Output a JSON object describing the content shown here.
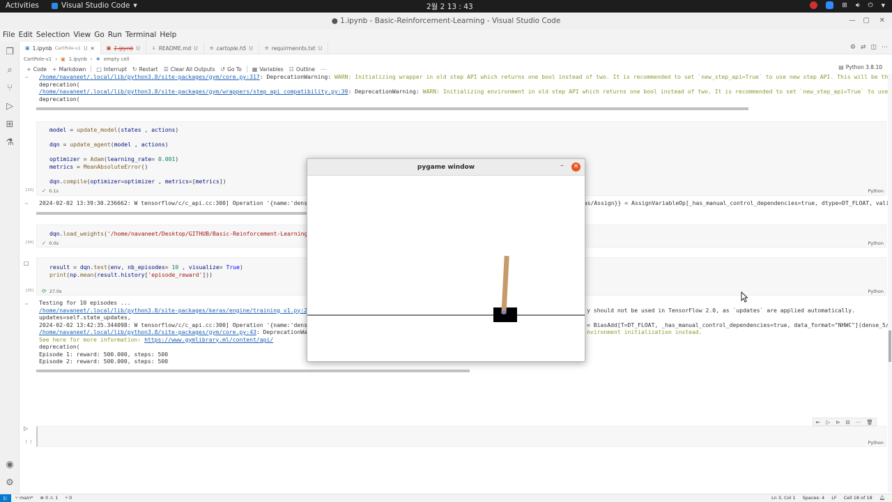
{
  "gnome": {
    "activities": "Activities",
    "app_name": "Visual Studio Code",
    "clock": "2월 2  13 : 43"
  },
  "window": {
    "title": "● 1.ipynb - Basic-Reinforcement-Learning - Visual Studio Code"
  },
  "menu": [
    "File",
    "Edit",
    "Selection",
    "View",
    "Go",
    "Run",
    "Terminal",
    "Help"
  ],
  "tabs": [
    {
      "label": "1.ipynb",
      "sub": "CartPole-v1",
      "mod": "U",
      "active": true
    },
    {
      "label": "1.ipynb",
      "sub": "",
      "mod": "U",
      "active": false
    },
    {
      "label": "README.md",
      "sub": "",
      "mod": "U",
      "active": false
    },
    {
      "label": "cartople.h5",
      "sub": "",
      "mod": "U",
      "active": false
    },
    {
      "label": "requirmennts.txt",
      "sub": "",
      "mod": "U",
      "active": false
    }
  ],
  "breadcrumb": [
    "CartPole-v1",
    "1.ipynb",
    "empty cell"
  ],
  "toolbar": {
    "code": "Code",
    "markdown": "Markdown",
    "interrupt": "Interrupt",
    "restart": "Restart",
    "clear": "Clear All Outputs",
    "goto": "Go To",
    "variables": "Variables",
    "outline": "Outline",
    "kernel": "Python 3.8.10"
  },
  "output1": {
    "line1_link": "/home/navaneet/.local/lib/python3.8/site-packages/gym/core.py:317",
    "line1_text": ": DeprecationWarning: ",
    "line1_warn": "WARN: Initializing wrapper in old step API which returns one bool instead of two. It is recommended to set `new_step_api=True` to use new step API. This will be the default",
    "line2": "  deprecation(",
    "line3_link": "/home/navaneet/.local/lib/python3.8/site-packages/gym/wrappers/step_api_compatibility.py:39",
    "line3_text": ": DeprecationWarning: ",
    "line3_warn": "WARN: Initializing environment in old step API which returns one bool instead of two. It is recommended to set `new_step_api=True` to use new step",
    "line4": "  deprecation("
  },
  "cell2": {
    "exec": "[33]",
    "status": "0.1s",
    "lang": "Python",
    "output": "2024-02-02 13:39:30.236662: W tensorflow/c/c_api.cc:300] Operation '{name:'dense_4",
    "output_right": "bias/Assign}} = AssignVariableOp[_has_manual_control_dependencies=true, dtype=DT_FLOAT, valic"
  },
  "cell3": {
    "exec": "[34]",
    "status": "0.0s",
    "lang": "Python",
    "path": "'/home/navaneet/Desktop/GITHUB/Basic-Reinforcement-Learning/Ca"
  },
  "cell4": {
    "exec": "[35]",
    "status": "27.0s",
    "lang": "Python",
    "out1": "Testing for 10 episodes ...",
    "out2_link": "/home/navaneet/.local/lib/python3.8/site-packages/keras/engine/training_v1.py:2359",
    "out2_right": "y should not be used in TensorFlow 2.0, as `updates` are applied automatically.",
    "out3": "  updates=self.state_updates,",
    "out4": "2024-02-02 13:42:35.344098: W tensorflow/c/c_api.cc:300] Operation '{name:'dense_5",
    "out4_right": "= BiasAdd[T=DT_FLOAT, _has_manual_control_dependencies=true, data_format=\"NHWC\"](dense_5/Ma",
    "out5_link": "/home/navaneet/.local/lib/python3.8/site-packages/gym/core.py:43",
    "out5_text": ": DeprecationWarni",
    "out5_right": "nvironment initialization instead.",
    "out6_pre": "See here for more information: ",
    "out6_link": "https://www.gymlibrary.ml/content/api/",
    "out7": "  deprecation(",
    "out8": "Episode 1: reward: 500.000, steps: 500",
    "out9": "Episode 2: reward: 500.000, steps: 500"
  },
  "cell5": {
    "exec": "[ ]",
    "lang": "Python"
  },
  "pygame": {
    "title": "pygame window",
    "pole_angle_deg": 3
  },
  "statusbar": {
    "branch": "main*",
    "problems": "⊗ 0 ⚠ 1",
    "ports": "⑂ 0",
    "position": "Ln 3, Col 1",
    "spaces": "Spaces: 4",
    "eol": "LF",
    "cell": "Cell 18 of 18"
  },
  "colors": {
    "accent": "#007acc",
    "close": "#e95420",
    "pole": "#c69a6a",
    "cart": "#000000"
  }
}
